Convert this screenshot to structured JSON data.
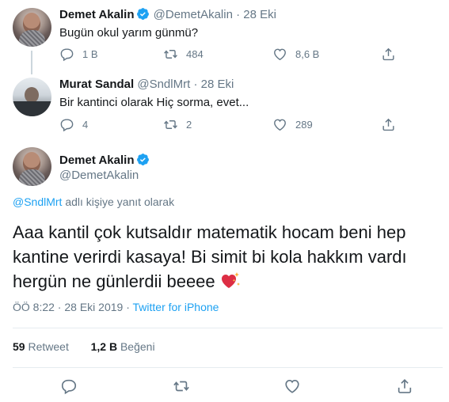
{
  "tweet1": {
    "name": "Demet Akalin",
    "handle": "@DemetAkalin",
    "date": "28 Eki",
    "text": "Bugün okul yarım günmü?",
    "reply_count": "1 B",
    "retweet_count": "484",
    "like_count": "8,6 B"
  },
  "tweet2": {
    "name": "Murat Sandal",
    "handle": "@SndlMrt",
    "date": "28 Eki",
    "text": "Bir kantinci olarak Hiç sorma, evet...",
    "reply_count": "4",
    "retweet_count": "2",
    "like_count": "289"
  },
  "main": {
    "name": "Demet Akalin",
    "handle": "@DemetAkalin",
    "reply_mention": "@SndlMrt",
    "reply_suffix": " adlı kişiye yanıt olarak",
    "text": "Aaa kantil çok kutsaldır matematik hocam beni hep kantine verirdi kasaya! Bi simit bi kola hakkım vardı hergün ne günlerdii beeee",
    "time": "ÖÖ 8:22 · 28 Eki 2019 · ",
    "source": "Twitter for iPhone",
    "retweets_count": "59",
    "retweets_label": "Retweet",
    "likes_count": "1,2 B",
    "likes_label": "Beğeni"
  },
  "colors": {
    "accent": "#1da1f2",
    "muted": "#657786",
    "text": "#14171a",
    "divider": "#e6ecf0"
  },
  "icons": [
    "verified-badge-icon",
    "reply-icon",
    "retweet-icon",
    "like-icon",
    "share-icon",
    "sparkling-heart-icon"
  ]
}
